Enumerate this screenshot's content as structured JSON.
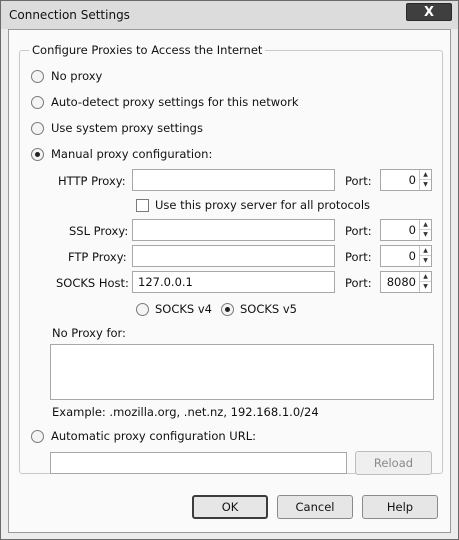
{
  "window": {
    "title": "Connection Settings",
    "close_glyph": "X"
  },
  "group": {
    "legend": "Configure Proxies to Access the Internet"
  },
  "options": {
    "no_proxy": {
      "label": "No proxy",
      "checked": false
    },
    "auto_detect": {
      "label": "Auto-detect proxy settings for this network",
      "checked": false
    },
    "system": {
      "label": "Use system proxy settings",
      "checked": false
    },
    "manual": {
      "label": "Manual proxy configuration:",
      "checked": true
    },
    "auto_url": {
      "label": "Automatic proxy configuration URL:",
      "checked": false
    }
  },
  "manual": {
    "http": {
      "label": "HTTP Proxy:",
      "value": "",
      "port_label": "Port:",
      "port": "0"
    },
    "use_for_all": {
      "label": "Use this proxy server for all protocols",
      "checked": false
    },
    "ssl": {
      "label": "SSL Proxy:",
      "value": "",
      "port_label": "Port:",
      "port": "0"
    },
    "ftp": {
      "label": "FTP Proxy:",
      "value": "",
      "port_label": "Port:",
      "port": "0"
    },
    "socks": {
      "label": "SOCKS Host:",
      "value": "127.0.0.1",
      "port_label": "Port:",
      "port": "8080"
    },
    "socks_v4": {
      "label": "SOCKS v4",
      "checked": false
    },
    "socks_v5": {
      "label": "SOCKS v5",
      "checked": true
    },
    "no_proxy_for": {
      "label": "No Proxy for:",
      "value": ""
    },
    "example": "Example: .mozilla.org, .net.nz, 192.168.1.0/24"
  },
  "auto_url": {
    "value": "",
    "reload_label": "Reload"
  },
  "buttons": {
    "ok": "OK",
    "cancel": "Cancel",
    "help": "Help"
  },
  "spinner": {
    "up_glyph": "▲",
    "down_glyph": "▼"
  }
}
